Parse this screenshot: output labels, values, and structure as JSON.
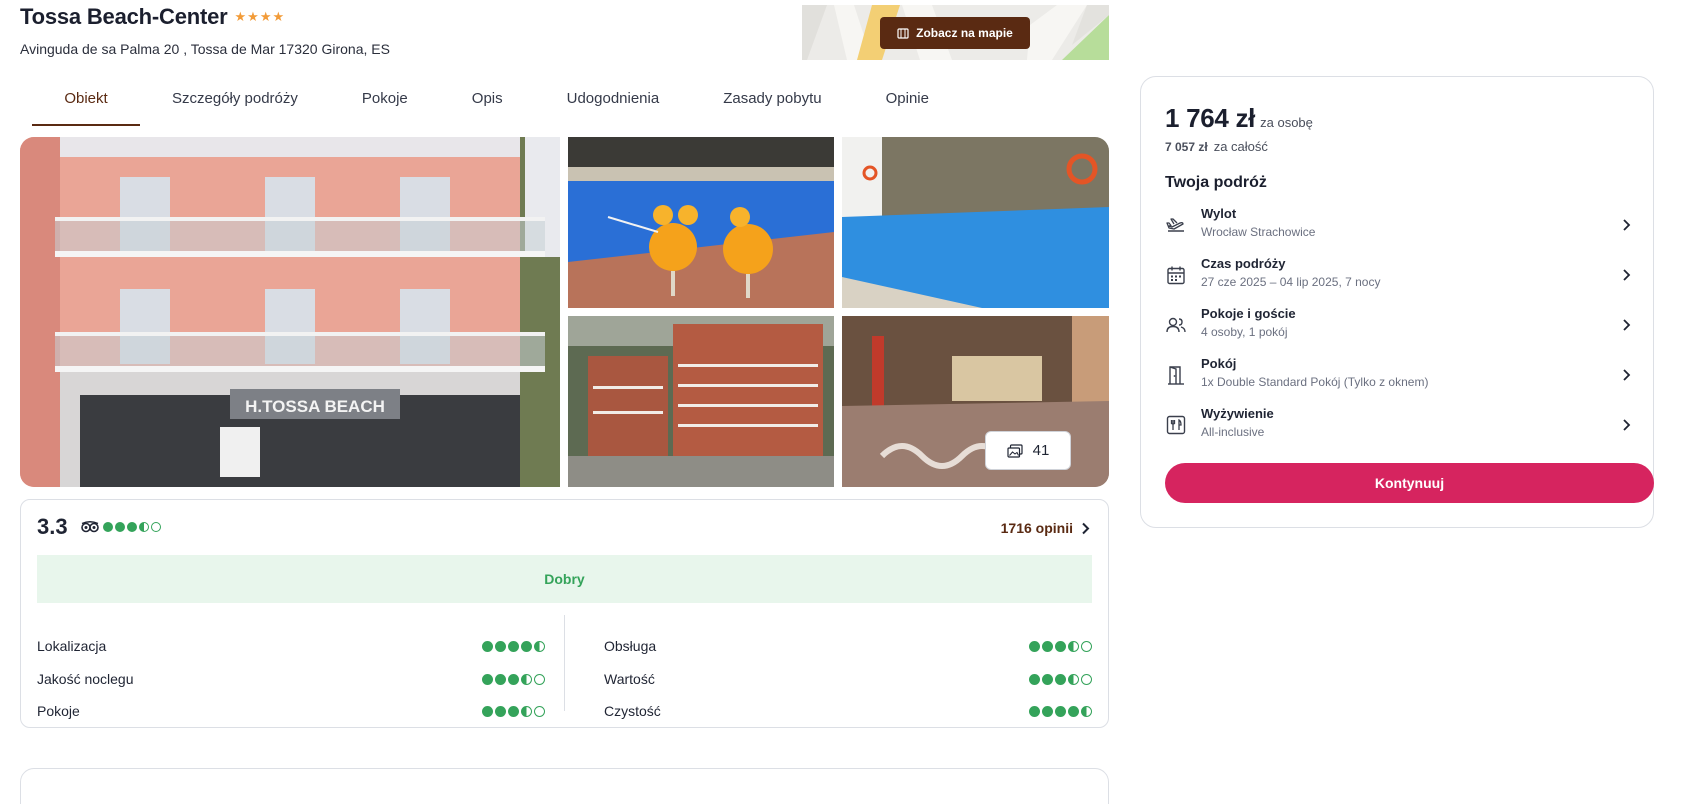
{
  "hotel": {
    "name": "Tossa Beach-Center",
    "stars": 4,
    "address": "Avinguda de sa Palma 20 , Tossa de Mar 17320 Girona, ES"
  },
  "map": {
    "button_label": "Zobacz na mapie"
  },
  "tabs": [
    {
      "label": "Obiekt",
      "active": true
    },
    {
      "label": "Szczegóły podróży"
    },
    {
      "label": "Pokoje"
    },
    {
      "label": "Opis"
    },
    {
      "label": "Udogodnienia"
    },
    {
      "label": "Zasady pobytu"
    },
    {
      "label": "Opinie"
    }
  ],
  "gallery": {
    "photo_count": "41",
    "sign_text": "H.TOSSA BEACH"
  },
  "rating": {
    "score": "3.3",
    "tripadvisor_dots": 3.5,
    "opinions_label": "1716 opinii",
    "grade": "Dobry",
    "criteria_left": [
      {
        "label": "Lokalizacja",
        "value": 4.5
      },
      {
        "label": "Jakość noclegu",
        "value": 3.5
      },
      {
        "label": "Pokoje",
        "value": 3.5
      }
    ],
    "criteria_right": [
      {
        "label": "Obsługa",
        "value": 3.5
      },
      {
        "label": "Wartość",
        "value": 3.5
      },
      {
        "label": "Czystość",
        "value": 4.5
      }
    ],
    "color": "#34a35a"
  },
  "booking": {
    "price": "1 764 zł",
    "price_unit": "za osobę",
    "total": "7 057 zł",
    "total_unit": "za całość",
    "section_title": "Twoja podróż",
    "rows": [
      {
        "title": "Wylot",
        "subtitle": "Wrocław Strachowice",
        "icon": "plane-departure-icon"
      },
      {
        "title": "Czas podróży",
        "subtitle": "27 cze 2025 – 04 lip 2025, 7 nocy",
        "icon": "calendar-icon"
      },
      {
        "title": "Pokoje i goście",
        "subtitle": "4 osoby, 1 pokój",
        "icon": "users-icon"
      },
      {
        "title": "Pokój",
        "subtitle": "1x Double Standard Pokój (Tylko z oknem)",
        "icon": "door-icon"
      },
      {
        "title": "Wyżywienie",
        "subtitle": "All-inclusive",
        "icon": "cutlery-icon"
      }
    ],
    "cta_label": "Kontynuuj",
    "cta_color": "#d6245f"
  },
  "colors": {
    "brand_brown": "#5a2a12",
    "star": "#f29b38"
  }
}
